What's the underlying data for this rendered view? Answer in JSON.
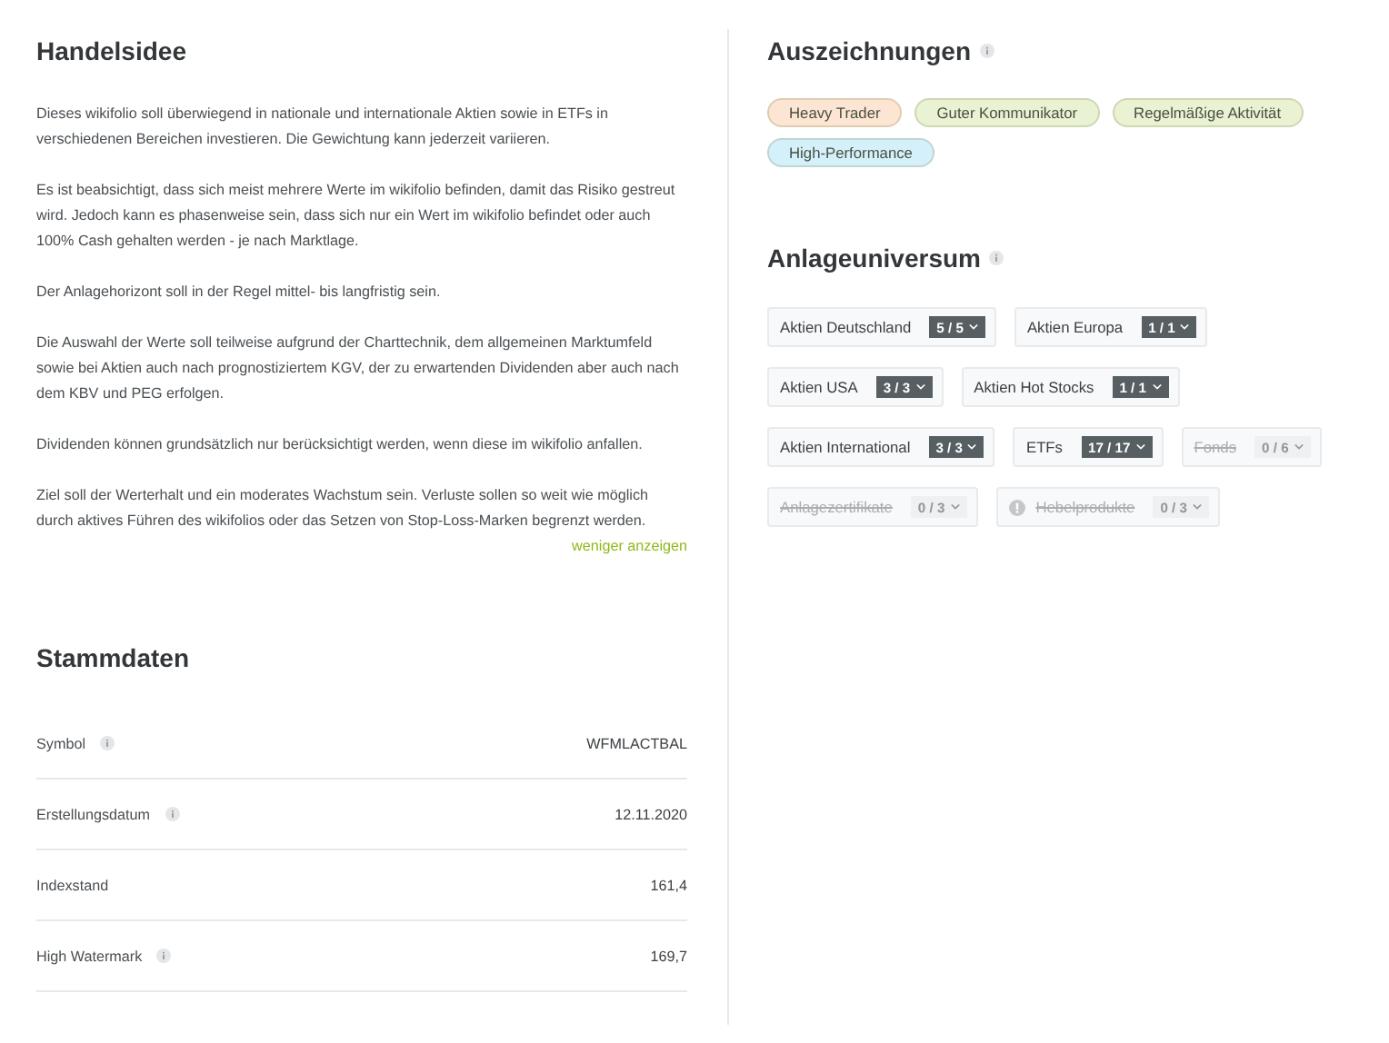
{
  "trading_idea": {
    "title": "Handelsidee",
    "paragraphs": [
      "Dieses wikifolio soll überwiegend in nationale und internationale Aktien sowie in ETFs in verschiedenen Bereichen investieren. Die Gewichtung kann jederzeit variieren.",
      "Es ist beabsichtigt, dass sich meist mehrere Werte im wikifolio befinden, damit das Risiko gestreut wird. Jedoch kann es phasenweise sein, dass sich nur ein Wert im wikifolio befindet oder auch 100% Cash gehalten werden - je nach Marktlage.",
      "Der Anlagehorizont soll in der Regel mittel- bis langfristig sein.",
      "Die Auswahl der Werte soll teilweise aufgrund der Charttechnik, dem allgemeinen Marktumfeld sowie bei Aktien auch nach prognostiziertem KGV, der zu erwartenden Dividenden aber auch nach dem KBV und PEG erfolgen.",
      "Dividenden können grundsätzlich nur berücksichtigt werden, wenn diese im wikifolio anfallen.",
      "Ziel soll der Werterhalt und ein moderates Wachstum sein. Verluste sollen so weit wie möglich durch aktives Führen des wikifolios oder das Setzen von Stop-Loss-Marken begrenzt werden."
    ],
    "toggle_link": "weniger anzeigen"
  },
  "master_data": {
    "title": "Stammdaten",
    "rows": [
      {
        "label": "Symbol",
        "info": true,
        "value": "WFMLACTBAL"
      },
      {
        "label": "Erstellungsdatum",
        "info": true,
        "value": "12.11.2020"
      },
      {
        "label": "Indexstand",
        "info": false,
        "value": "161,4"
      },
      {
        "label": "High Watermark",
        "info": true,
        "value": "169,7"
      }
    ]
  },
  "awards": {
    "title": "Auszeichnungen",
    "badges": [
      {
        "label": "Heavy Trader",
        "color": "#fde5d3"
      },
      {
        "label": "Guter Kommunikator",
        "color": "#e9f2d3"
      },
      {
        "label": "Regelmäßige Aktivität",
        "color": "#e9f2d3"
      },
      {
        "label": "High-Performance",
        "color": "#d4f1fb"
      }
    ]
  },
  "investment_universe": {
    "title": "Anlageuniversum",
    "items": [
      {
        "label": "Aktien Deutschland",
        "count": "5 / 5",
        "disabled": false,
        "warning": false
      },
      {
        "label": "Aktien Europa",
        "count": "1 / 1",
        "disabled": false,
        "warning": false
      },
      {
        "label": "Aktien USA",
        "count": "3 / 3",
        "disabled": false,
        "warning": false
      },
      {
        "label": "Aktien Hot Stocks",
        "count": "1 / 1",
        "disabled": false,
        "warning": false
      },
      {
        "label": "Aktien International",
        "count": "3 / 3",
        "disabled": false,
        "warning": false
      },
      {
        "label": "ETFs",
        "count": "17 / 17",
        "disabled": false,
        "warning": false
      },
      {
        "label": "Fonds",
        "count": "0 / 6",
        "disabled": true,
        "warning": false
      },
      {
        "label": "Anlagezertifikate",
        "count": "0 / 3",
        "disabled": true,
        "warning": false
      },
      {
        "label": "Hebelprodukte",
        "count": "0 / 3",
        "disabled": true,
        "warning": true
      }
    ]
  }
}
